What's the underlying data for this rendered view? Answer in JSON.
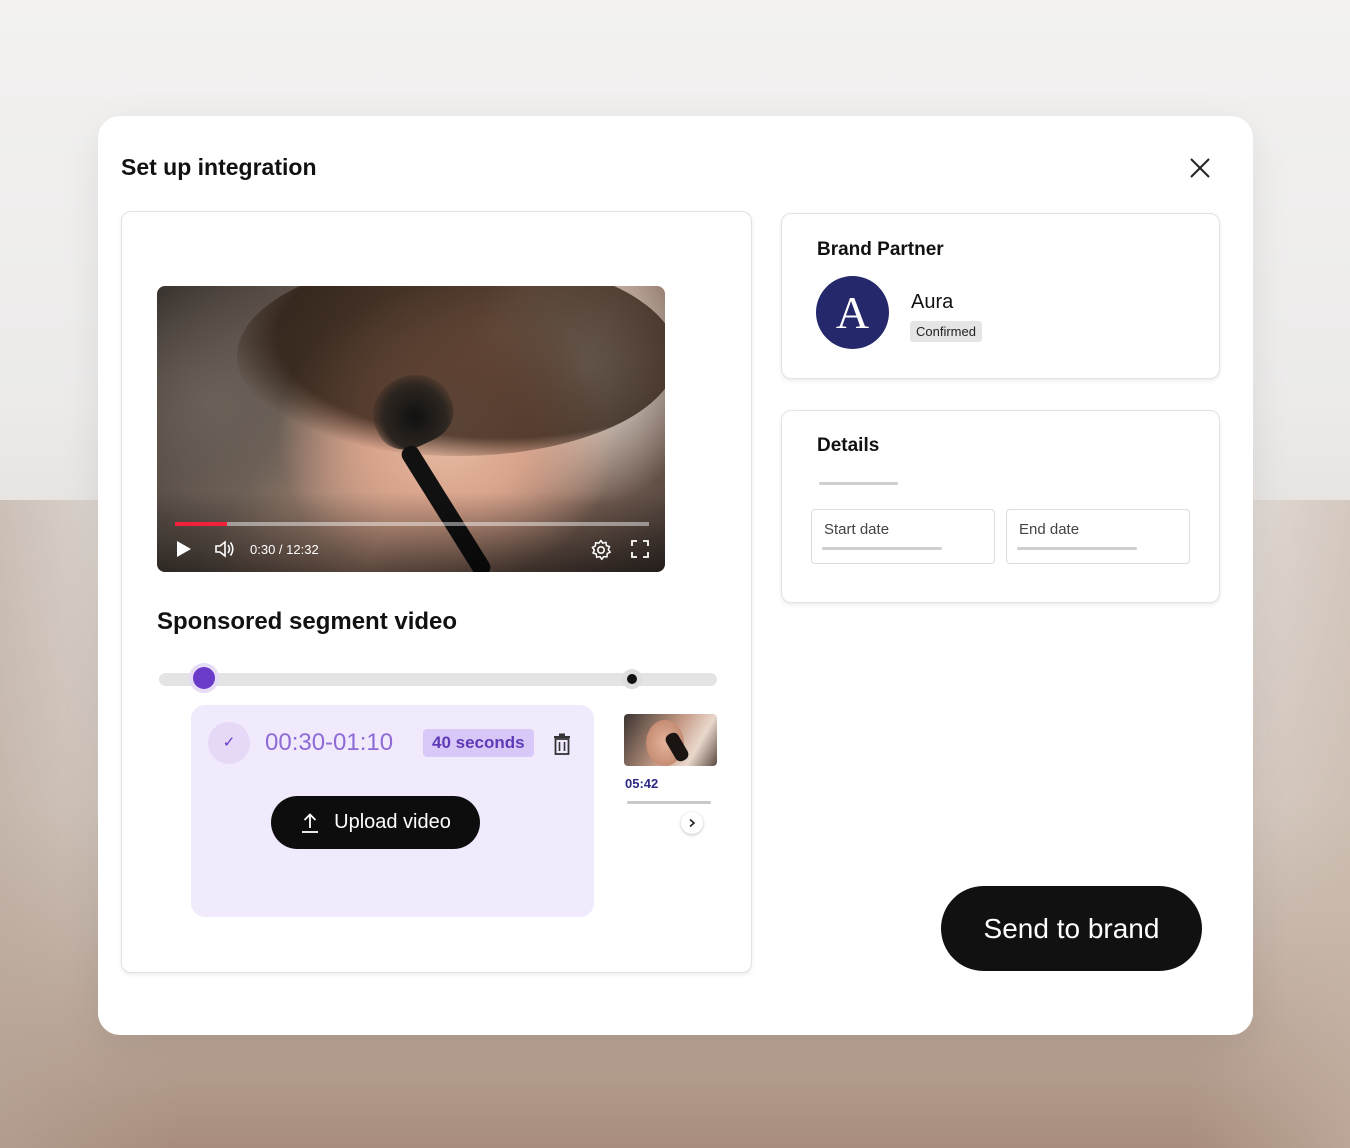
{
  "modal": {
    "title": "Set up integration",
    "close_icon": "close-icon"
  },
  "video": {
    "current_time": "0:30",
    "duration": "12:32",
    "time_display": "0:30 / 12:32",
    "progress_fraction": 0.024,
    "play_icon": "play-icon",
    "volume_icon": "volume-icon",
    "settings_icon": "gear-icon",
    "fullscreen_icon": "fullscreen-icon"
  },
  "segment": {
    "title": "Sponsored segment video",
    "range": "00:30-01:10",
    "duration_badge": "40 seconds",
    "upload_label": "Upload video",
    "thumbnail_time": "05:42"
  },
  "brand": {
    "heading": "Brand Partner",
    "logo_letter": "A",
    "name": "Aura",
    "status": "Confirmed",
    "accent_color": "#25286b"
  },
  "details": {
    "heading": "Details",
    "start_label": "Start date",
    "end_label": "End date"
  },
  "actions": {
    "send_label": "Send to brand"
  },
  "colors": {
    "accent": "#6a3ac9",
    "segment_bg": "#f1e9fc",
    "progress": "#f0213a"
  }
}
